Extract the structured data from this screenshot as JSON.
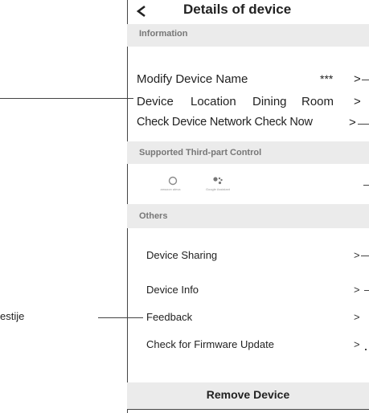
{
  "header": {
    "back_icon": "back-chevron-icon",
    "title": "Details of device"
  },
  "sections": {
    "information": "Information",
    "third_party": "Supported Third-part Control",
    "others": "Others"
  },
  "information_rows": {
    "modify_name_label": "Modify Device Name",
    "modify_name_value": "***",
    "location_label": "Device",
    "location_word2": "Location",
    "location_word3": "Dining",
    "location_word4": "Room",
    "network_label": "Check Device Network Check Now",
    "chevron": ">"
  },
  "third_party": {
    "alexa_icon": "amazon-alexa-icon",
    "alexa_label": "amazon alexa",
    "google_icon": "google-assistant-icon",
    "google_label": "Google Assistant"
  },
  "others_rows": {
    "sharing": "Device Sharing",
    "info": "Device Info",
    "feedback": "Feedback",
    "firmware": "Check for Firmware Update",
    "chevron": ">"
  },
  "footer": {
    "remove_label": "Remove Device"
  },
  "left_annotations": {
    "feedback_label": "estije"
  },
  "colors": {
    "section_bg": "#ebebeb",
    "section_text": "#777777",
    "border": "#444444"
  }
}
